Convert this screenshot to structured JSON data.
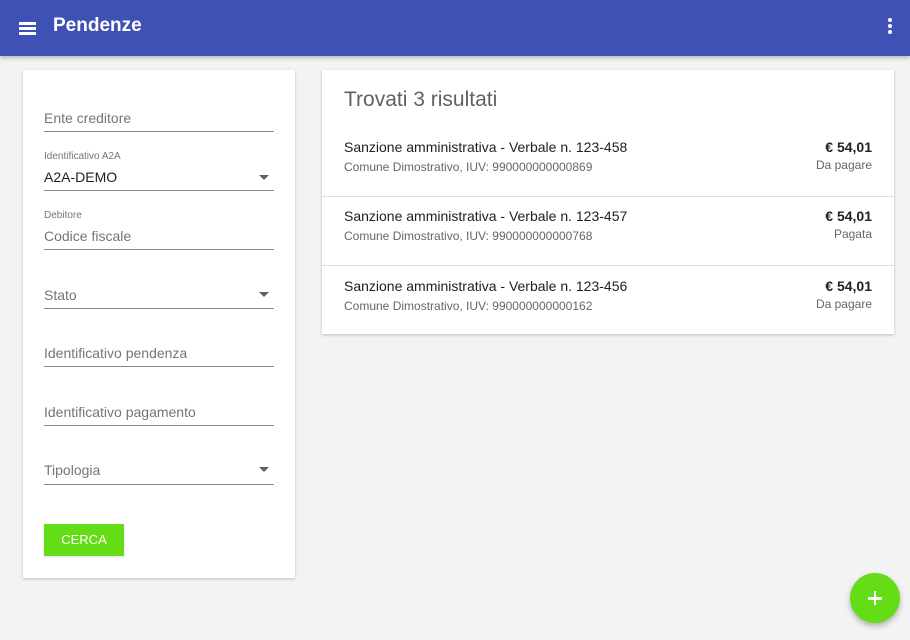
{
  "app": {
    "title": "Pendenze"
  },
  "filters": {
    "ente_creditore": {
      "placeholder": "Ente creditore"
    },
    "identificativo_a2a": {
      "label": "Identificativo A2A",
      "value": "A2A-DEMO"
    },
    "debitore": {
      "label": "Debitore",
      "placeholder": "Codice fiscale"
    },
    "stato": {
      "placeholder": "Stato"
    },
    "identificativo_pendenza": {
      "placeholder": "Identificativo pendenza"
    },
    "identificativo_pagamento": {
      "placeholder": "Identificativo pagamento"
    },
    "tipologia": {
      "placeholder": "Tipologia"
    },
    "search_label": "CERCA"
  },
  "results": {
    "heading": "Trovati 3 risultati",
    "items": [
      {
        "title": "Sanzione amministrativa - Verbale n. 123-458",
        "subtitle": "Comune Dimostrativo, IUV: 990000000000869",
        "amount": "€ 54,01",
        "status": "Da pagare"
      },
      {
        "title": "Sanzione amministrativa - Verbale n. 123-457",
        "subtitle": "Comune Dimostrativo, IUV: 990000000000768",
        "amount": "€ 54,01",
        "status": "Pagata"
      },
      {
        "title": "Sanzione amministrativa - Verbale n. 123-456",
        "subtitle": "Comune Dimostrativo, IUV: 990000000000162",
        "amount": "€ 54,01",
        "status": "Da pagare"
      }
    ]
  },
  "icons": {
    "menu": "menu-icon",
    "more": "more-vert-icon",
    "dropdown": "arrow-drop-down-icon",
    "add": "add-icon"
  },
  "colors": {
    "appbar": "#3f51b5",
    "accent": "#64dd17",
    "background": "#f3f3f3"
  }
}
